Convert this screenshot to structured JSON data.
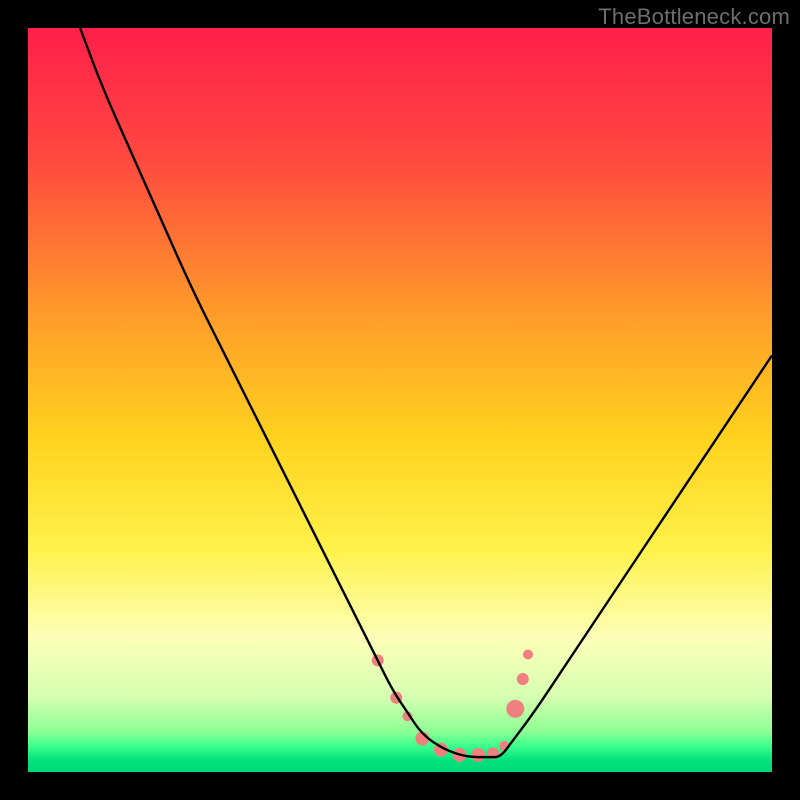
{
  "watermark": "TheBottleneck.com",
  "chart_data": {
    "type": "line",
    "title": "",
    "xlabel": "",
    "ylabel": "",
    "xlim": [
      0,
      100
    ],
    "ylim": [
      0,
      100
    ],
    "grid": false,
    "legend": false,
    "annotations": [],
    "gradient_stops": [
      {
        "offset": 0.0,
        "color": "#ff1f4b"
      },
      {
        "offset": 0.18,
        "color": "#ff4a3f"
      },
      {
        "offset": 0.38,
        "color": "#ff9a2a"
      },
      {
        "offset": 0.55,
        "color": "#ffd21e"
      },
      {
        "offset": 0.7,
        "color": "#fff24a"
      },
      {
        "offset": 0.82,
        "color": "#fdffb8"
      },
      {
        "offset": 0.9,
        "color": "#d4ffb0"
      },
      {
        "offset": 0.945,
        "color": "#8eff95"
      },
      {
        "offset": 0.965,
        "color": "#3cff8c"
      },
      {
        "offset": 0.985,
        "color": "#00e27d"
      },
      {
        "offset": 1.0,
        "color": "#00d874"
      }
    ],
    "series": [
      {
        "name": "bottleneck-curve",
        "stroke": "#000000",
        "x": [
          7,
          10,
          14,
          18,
          22,
          26,
          30,
          34,
          38,
          41,
          44,
          47,
          49,
          51,
          53,
          56,
          59,
          62,
          63.5,
          65,
          68,
          72,
          76,
          80,
          84,
          88,
          92,
          96,
          100
        ],
        "values": [
          100,
          92,
          83,
          74,
          65,
          57,
          49,
          41,
          33,
          27,
          21,
          15,
          11,
          8,
          5,
          3,
          2,
          2,
          2,
          4,
          8,
          14,
          20,
          26,
          32,
          38,
          44,
          50,
          56
        ]
      }
    ],
    "markers": {
      "name": "highlight-dots",
      "fill": "#f08080",
      "points": [
        {
          "x": 47.0,
          "y": 15.0,
          "r": 6
        },
        {
          "x": 49.5,
          "y": 10.0,
          "r": 6
        },
        {
          "x": 51.0,
          "y": 7.5,
          "r": 5
        },
        {
          "x": 53.0,
          "y": 4.5,
          "r": 7
        },
        {
          "x": 55.5,
          "y": 3.0,
          "r": 7
        },
        {
          "x": 58.0,
          "y": 2.3,
          "r": 7
        },
        {
          "x": 60.5,
          "y": 2.3,
          "r": 7
        },
        {
          "x": 62.5,
          "y": 2.5,
          "r": 6
        },
        {
          "x": 64.0,
          "y": 3.5,
          "r": 5
        },
        {
          "x": 65.5,
          "y": 8.5,
          "r": 9
        },
        {
          "x": 66.5,
          "y": 12.5,
          "r": 6
        },
        {
          "x": 67.2,
          "y": 15.8,
          "r": 5
        }
      ]
    }
  }
}
